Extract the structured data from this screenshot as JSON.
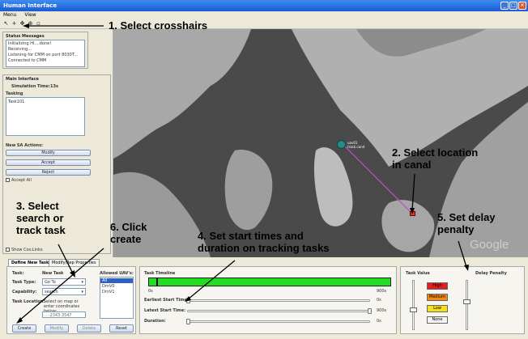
{
  "window": {
    "title": "Human Interface"
  },
  "menu": {
    "items": [
      "Menu",
      "View"
    ]
  },
  "status": {
    "title": "Status Messages",
    "lines": [
      "Initializing HI....done!",
      "Receiving...",
      "Listening for CMM on port 8030T...",
      "Connected to CMM"
    ]
  },
  "main_interface": {
    "title": "Main Interface",
    "sim_time_label": "Simulation Time:",
    "sim_time_value": "13s",
    "tasking_label": "Tasking",
    "task_entry": "Task101",
    "new_sa_label": "New SA Actions:",
    "modify": "Modify",
    "accept": "Accept",
    "reject": "Reject",
    "accept_all": "Accept All",
    "show_cov": "Show Cov.Links"
  },
  "map": {
    "marker_label": "uav01\ntrack.cand",
    "watermark": "Google",
    "track_color": "#c050c0",
    "marker_color": "#2a8a8a",
    "target_color": "#e04020"
  },
  "annotations": {
    "a1": "1. Select crosshairs",
    "a2": "2. Select location\nin canal",
    "a3": "3. Select\nsearch or\ntrack task",
    "a4": "4. Set start times and\nduration on tracking tasks",
    "a5": "5. Set delay\npenalty",
    "a6": "6. Click\ncreate"
  },
  "tabs": [
    "Define New Task",
    "Modify/Rep Properties"
  ],
  "task_form": {
    "task_label": "Task:",
    "task_value": "New Task",
    "type_label": "Task Type:",
    "type_value": "Go To",
    "capability_label": "Capability:",
    "capability_value": "search",
    "location_label": "Task Location:",
    "location_hint": "Select on map or enter coordinates below:",
    "location_value": "...-2343.3547",
    "uav_label": "Allowed UAV's:",
    "uavs": [
      "All",
      "DrnV0",
      "DrnV1"
    ],
    "create": "Create",
    "modify": "Modify",
    "delete": "Delete",
    "reset": "Reset"
  },
  "timeline": {
    "title": "Task Timeline",
    "start": "0s",
    "end": "900s",
    "earliest_label": "Earliest Start Time:",
    "earliest_value": "0s",
    "latest_label": "Latest Start Time:",
    "latest_value": "900s",
    "duration_label": "Duration:",
    "duration_value": "0s",
    "bar_color": "#22dd22"
  },
  "priority": {
    "task_value_label": "Task Value",
    "delay_label": "Delay Penalty",
    "levels": [
      {
        "name": "High",
        "color": "#e02020"
      },
      {
        "name": "Medium",
        "color": "#f08a10"
      },
      {
        "name": "Low",
        "color": "#f0e020"
      },
      {
        "name": "None",
        "color": "#f4f4f4"
      }
    ]
  }
}
